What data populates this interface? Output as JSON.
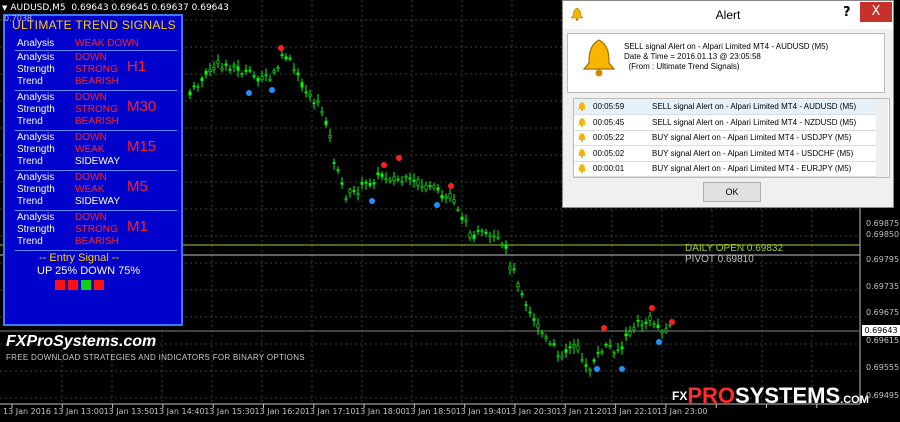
{
  "symbol": {
    "name": "AUDUSD,M5",
    "ohlc": "0.69643 0.69645 0.69637 0.69643"
  },
  "top_price_left": "0.7038",
  "panel": {
    "title": "ULTIMATE TREND SIGNALS",
    "rows": [
      {
        "analysis": "WEAK DOWN",
        "strength": "",
        "trend": "",
        "tf": ""
      },
      {
        "analysis": "DOWN",
        "strength": "STRONG",
        "trend": "BEARISH",
        "tf": "H1"
      },
      {
        "analysis": "DOWN",
        "strength": "STRONG",
        "trend": "BEARISH",
        "tf": "M30"
      },
      {
        "analysis": "DOWN",
        "strength": "WEAK",
        "trend": "SIDEWAY",
        "tf": "M15"
      },
      {
        "analysis": "DOWN",
        "strength": "WEAK",
        "trend": "SIDEWAY",
        "tf": "M5"
      },
      {
        "analysis": "DOWN",
        "strength": "STRONG",
        "trend": "BEARISH",
        "tf": "M1"
      }
    ],
    "labels": {
      "analysis": "Analysis",
      "strength": "Strength",
      "trend": "Trend"
    },
    "entry_label": "--  Entry Signal  --",
    "up_down": "UP 25%    DOWN 75%",
    "squares": [
      "#ff1010",
      "#ff1010",
      "#10d010",
      "#ff1010"
    ]
  },
  "brand": {
    "name": "FXProSystems.com",
    "tagline": "FREE DOWNLOAD STRATEGIES AND INDICATORS FOR BINARY OPTIONS"
  },
  "logo": {
    "fx": "FX",
    "pro": "PRO",
    "sys": "SYSTEMS",
    "com": ".COM"
  },
  "y_axis": [
    "0.69875",
    "0.69850",
    "0.69795",
    "0.69735",
    "0.69675",
    "0.69615",
    "0.69555",
    "0.69495"
  ],
  "price_box": "0.69643",
  "levels": {
    "daily_open": "DAILY OPEN 0.69832",
    "pivot": "PIVOT 0.69810"
  },
  "x_axis": [
    "13 Jan 2016",
    "13 Jan 13:00",
    "13 Jan 13:50",
    "13 Jan 14:40",
    "13 Jan 15:30",
    "13 Jan 16:20",
    "13 Jan 17:10",
    "13 Jan 18:00",
    "13 Jan 18:50",
    "13 Jan 19:40",
    "13 Jan 20:30",
    "13 Jan 21:20",
    "13 Jan 22:10",
    "13 Jan 23:00"
  ],
  "alert": {
    "title": "Alert",
    "help": "?",
    "close": "X",
    "message": "SELL signal Alert on - Alpari Limited MT4 - AUDUSD (M5)\nDate & Time = 2016.01.13 @ 23:05:58\n  (From : Ultimate Trend Signals)",
    "list": [
      {
        "time": "00:05:59",
        "msg": "SELL signal Alert on - Alpari Limited MT4 - AUDUSD (M5)"
      },
      {
        "time": "00:05:45",
        "msg": "SELL signal Alert on - Alpari Limited MT4 - NZDUSD (M5)"
      },
      {
        "time": "00:05:22",
        "msg": "BUY signal Alert on - Alpari Limited MT4 - USDJPY (M5)"
      },
      {
        "time": "00:05:02",
        "msg": "BUY signal Alert on - Alpari Limited MT4 - USDCHF (M5)"
      },
      {
        "time": "00:00:01",
        "msg": "BUY signal Alert on - Alpari Limited MT4 - EURJPY (M5)"
      }
    ],
    "ok": "OK"
  },
  "colors": {
    "bg": "#000000",
    "panel": "#0000cc",
    "candle": "#00ff00",
    "sell_dot": "#ff2020",
    "buy_dot": "#1e90ff",
    "daily_open": "#9acd32",
    "pivot": "#c0c0c0"
  }
}
